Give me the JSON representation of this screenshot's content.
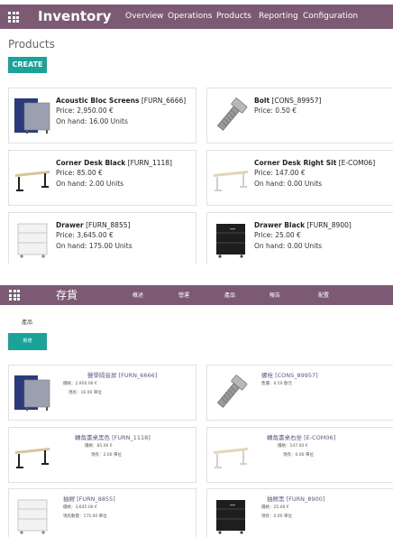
{
  "colors": {
    "navbar": "#7c5a74",
    "primary_button": "#1aa39a",
    "card_border": "#dee2e6"
  },
  "english_view": {
    "app_title": "Inventory",
    "menu": [
      "Overview",
      "Operations",
      "Products",
      "Reporting",
      "Configuration"
    ],
    "breadcrumb": "Products",
    "create_label": "CREATE",
    "products": [
      {
        "name": "Acoustic Bloc Screens",
        "ref": "[FURN_6666]",
        "price": "Price: 2,950.00 €",
        "onhand": "On hand: 16.00 Units",
        "icon": "acoustic-screen-icon"
      },
      {
        "name": "Bolt",
        "ref": "[CONS_89957]",
        "price": "Price: 0.50 €",
        "onhand": "",
        "icon": "bolt-icon"
      },
      {
        "name": "Corner Desk Black",
        "ref": "[FURN_1118]",
        "price": "Price: 85.00 €",
        "onhand": "On hand: 2.00 Units",
        "icon": "desk-black-icon"
      },
      {
        "name": "Corner Desk Right Sit",
        "ref": "[E-COM06]",
        "price": "Price: 147.00 €",
        "onhand": "On hand: 0.00 Units",
        "icon": "desk-white-icon"
      },
      {
        "name": "Drawer",
        "ref": "[FURN_8855]",
        "price": "Price: 3,645.00 €",
        "onhand": "On hand: 175.00 Units",
        "icon": "drawer-white-icon"
      },
      {
        "name": "Drawer Black",
        "ref": "[FURN_8900]",
        "price": "Price: 25.00 €",
        "onhand": "On hand: 0.00 Units",
        "icon": "drawer-black-icon"
      }
    ]
  },
  "chinese_view": {
    "app_title": "存貨",
    "menu": [
      "概述",
      "營運",
      "產品",
      "報告",
      "配置"
    ],
    "breadcrumb": "產品",
    "create_label": "新增",
    "products": [
      {
        "title": "聲學隔音屏 [FURN_6666]",
        "price": "價格：2,950.00 €",
        "onhand": "現有：16.00 單位",
        "icon": "acoustic-screen-icon"
      },
      {
        "title": "螺栓 [CONS_89957]",
        "price": "售價：0.50 歐元",
        "onhand": "",
        "icon": "bolt-icon"
      },
      {
        "title": "轉角書桌黑色 [FURN_1118]",
        "price": "價格：85.00 €",
        "onhand": "現有：2.00 單位",
        "icon": "desk-black-icon"
      },
      {
        "title": "轉角書桌右坐 [E-COM06]",
        "price": "價格：147.00 €",
        "onhand": "現有：0.00 單位",
        "icon": "desk-white-icon"
      },
      {
        "title": "抽屜 [FURN_8855]",
        "price": "價格：3,645.00 €",
        "onhand": "現有數量：175.00 單位",
        "icon": "drawer-white-icon"
      },
      {
        "title": "抽屜黑 [FURN_8900]",
        "price": "價格：25.00 €",
        "onhand": "現有：0.00 單位",
        "icon": "drawer-black-icon"
      }
    ]
  }
}
